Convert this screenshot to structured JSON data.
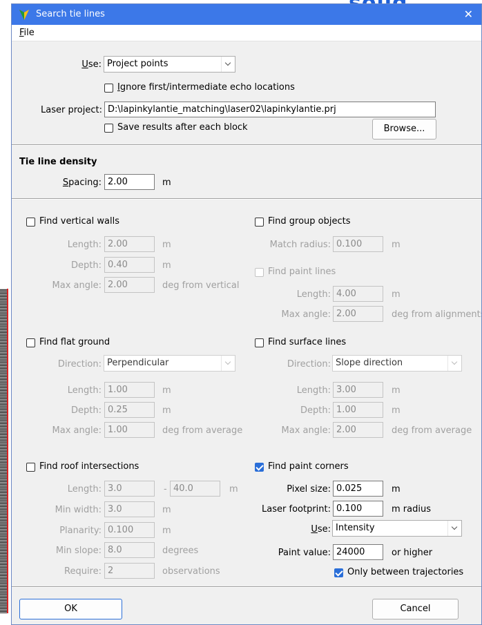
{
  "window": {
    "title": "Search tie lines",
    "close": "✕"
  },
  "menu": {
    "file_u": "F",
    "file_rest": "ile"
  },
  "top": {
    "use_u": "U",
    "use_rest": "se:",
    "use_value": "Project points",
    "ignore_u": "I",
    "ignore_rest": "gnore first/intermediate echo locations",
    "laser_project_label": "Laser project:",
    "laser_project_value": "D:\\lapinkylantie_matching\\laser02\\lapinkylantie.prj",
    "save_results": "Save results after each block",
    "browse": "Browse..."
  },
  "density": {
    "header": "Tie line density",
    "spacing_u": "S",
    "spacing_rest": "pacing:",
    "spacing_value": "2.00",
    "spacing_unit": "m"
  },
  "walls": {
    "title": "Find vertical walls",
    "length_label": "Length:",
    "length_value": "2.00",
    "length_unit": "m",
    "depth_label": "Depth:",
    "depth_value": "0.40",
    "depth_unit": "m",
    "maxangle_label": "Max angle:",
    "maxangle_value": "2.00",
    "maxangle_unit": "deg from vertical"
  },
  "group": {
    "title": "Find group objects",
    "match_label": "Match radius:",
    "match_value": "0.100",
    "match_unit": "m"
  },
  "paintlines": {
    "title": "Find paint lines",
    "length_label": "Length:",
    "length_value": "4.00",
    "length_unit": "m",
    "maxangle_label": "Max angle:",
    "maxangle_value": "2.00",
    "maxangle_unit": "deg from alignments"
  },
  "flat": {
    "title": "Find flat ground",
    "direction_label": "Direction:",
    "direction_value": "Perpendicular",
    "length_label": "Length:",
    "length_value": "1.00",
    "length_unit": "m",
    "depth_label": "Depth:",
    "depth_value": "0.25",
    "depth_unit": "m",
    "maxangle_label": "Max angle:",
    "maxangle_value": "1.00",
    "maxangle_unit": "deg from average"
  },
  "surface": {
    "title": "Find surface lines",
    "direction_label": "Direction:",
    "direction_value": "Slope direction",
    "length_label": "Length:",
    "length_value": "3.00",
    "length_unit": "m",
    "depth_label": "Depth:",
    "depth_value": "1.00",
    "depth_unit": "m",
    "maxangle_label": "Max angle:",
    "maxangle_value": "2.00",
    "maxangle_unit": "deg from average"
  },
  "roof": {
    "title": "Find roof intersections",
    "length_label": "Length:",
    "length_min": "3.0",
    "dash": "-",
    "length_max": "40.0",
    "length_unit": "m",
    "minwidth_label": "Min width:",
    "minwidth_value": "3.0",
    "minwidth_unit": "m",
    "planarity_label": "Planarity:",
    "planarity_value": "0.100",
    "planarity_unit": "m",
    "minslope_label": "Min slope:",
    "minslope_value": "8.0",
    "minslope_unit": "degrees",
    "require_label": "Require:",
    "require_value": "2",
    "require_unit": "observations"
  },
  "corners": {
    "title": "Find paint corners",
    "pixel_label": "Pixel size:",
    "pixel_value": "0.025",
    "pixel_unit": "m",
    "footprint_label": "Laser footprint:",
    "footprint_value": "0.100",
    "footprint_unit": "m radius",
    "use_u": "U",
    "use_rest": "se:",
    "use_value": "Intensity",
    "paint_label": "Paint value:",
    "paint_value": "24000",
    "paint_unit": "or higher",
    "only_between": "Only between trajectories"
  },
  "buttons": {
    "ok": "OK",
    "cancel": "Cancel"
  },
  "colors": {
    "titlebar": "#3c78e8",
    "accent": "#2a6ed8",
    "window_bg": "#f0f0f0",
    "disabled_text": "#a0a0a0"
  },
  "background": {
    "logo_text": "solid"
  }
}
